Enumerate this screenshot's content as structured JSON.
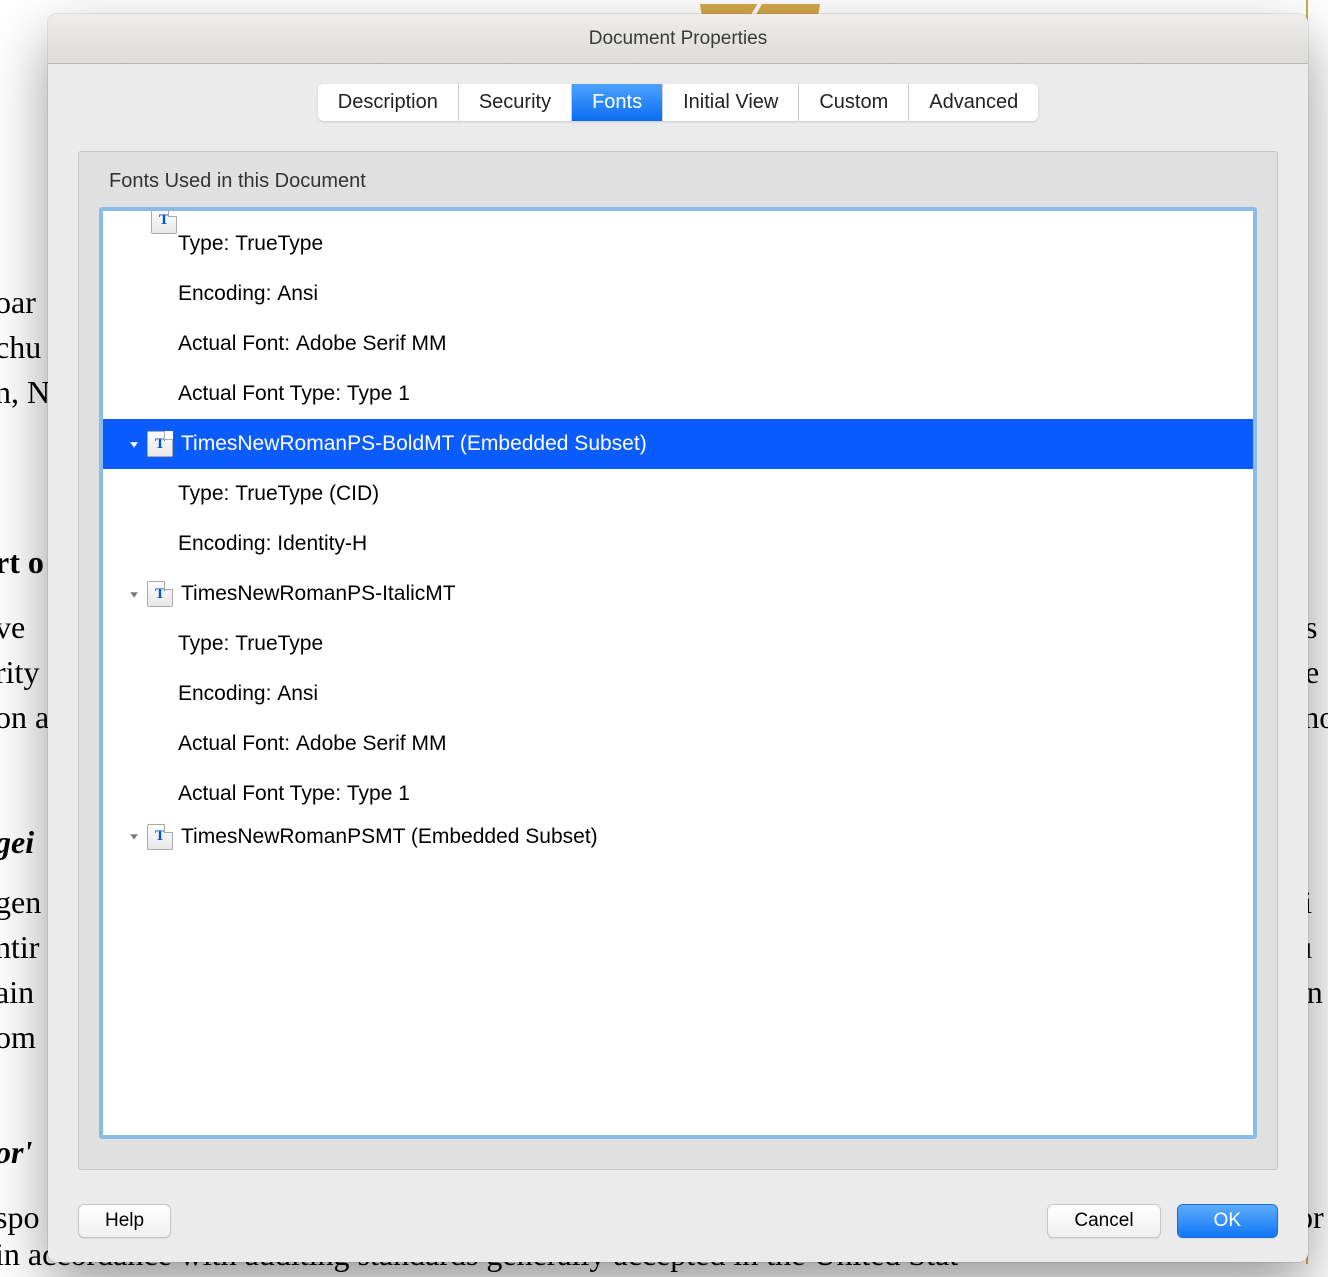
{
  "dialog": {
    "title": "Document Properties",
    "tabs": [
      "Description",
      "Security",
      "Fonts",
      "Initial View",
      "Custom",
      "Advanced"
    ],
    "active_tab": "Fonts",
    "panel_label": "Fonts Used in this Document",
    "help_label": "Help",
    "cancel_label": "Cancel",
    "ok_label": "OK"
  },
  "fonts": {
    "prop_labels": {
      "type": "Type:",
      "encoding": "Encoding:",
      "actual_font": "Actual Font:",
      "actual_font_type": "Actual Font Type:"
    },
    "items": [
      {
        "name": "",
        "props": {
          "type": "TrueType",
          "encoding": "Ansi",
          "actual_font": "Adobe Serif MM",
          "actual_font_type": "Type 1"
        }
      },
      {
        "name": "TimesNewRomanPS-BoldMT (Embedded Subset)",
        "selected": true,
        "props": {
          "type": "TrueType (CID)",
          "encoding": "Identity-H"
        }
      },
      {
        "name": "TimesNewRomanPS-ItalicMT",
        "props": {
          "type": "TrueType",
          "encoding": "Ansi",
          "actual_font": "Adobe Serif MM",
          "actual_font_type": "Type 1"
        }
      },
      {
        "name": "TimesNewRomanPSMT (Embedded Subset)"
      }
    ]
  },
  "bg": {
    "left": [
      "oar",
      "chu",
      "n, N",
      "rt o",
      "ve",
      "rity",
      "on a",
      "gei",
      "gen",
      "ntir",
      "ain",
      "om",
      "or'",
      "spo"
    ],
    "right": [
      "etts",
      "nue",
      "nano",
      "nci",
      "clu",
      "tion",
      "d or"
    ],
    "bottom": "in accordance with auditing standards generally accepted in the United Stat"
  }
}
